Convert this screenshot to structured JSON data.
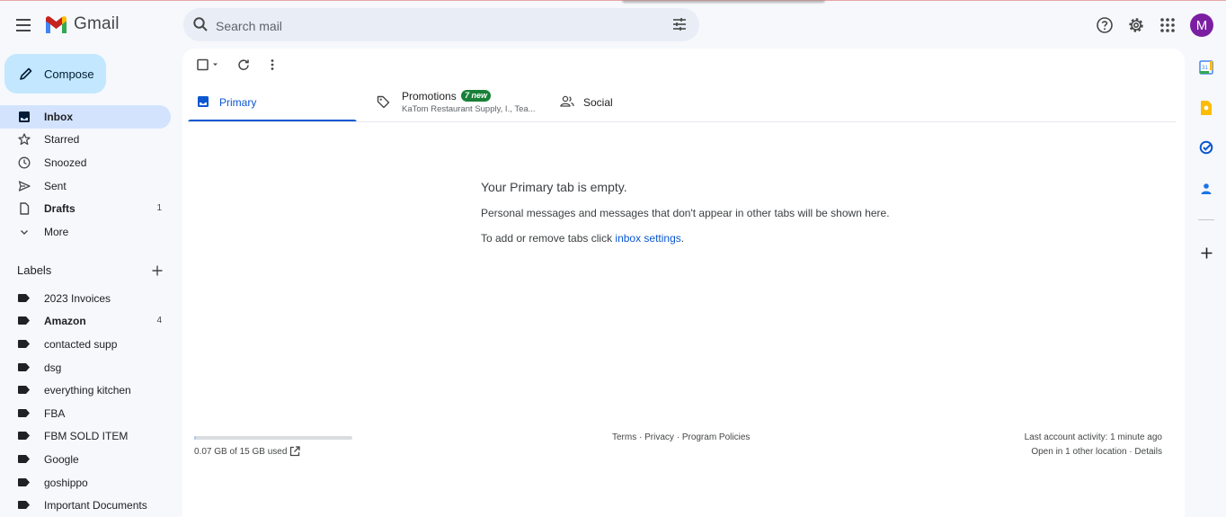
{
  "app": {
    "name": "Gmail"
  },
  "search": {
    "placeholder": "Search mail"
  },
  "account": {
    "avatar_letter": "M"
  },
  "compose": {
    "label": "Compose"
  },
  "nav": {
    "items": [
      {
        "label": "Inbox",
        "count": ""
      },
      {
        "label": "Starred",
        "count": ""
      },
      {
        "label": "Snoozed",
        "count": ""
      },
      {
        "label": "Sent",
        "count": ""
      },
      {
        "label": "Drafts",
        "count": "1"
      },
      {
        "label": "More",
        "count": ""
      }
    ]
  },
  "labels": {
    "title": "Labels",
    "items": [
      {
        "label": "2023 Invoices",
        "count": ""
      },
      {
        "label": "Amazon",
        "count": "4"
      },
      {
        "label": "contacted supp",
        "count": ""
      },
      {
        "label": "dsg",
        "count": ""
      },
      {
        "label": "everything kitchen",
        "count": ""
      },
      {
        "label": "FBA",
        "count": ""
      },
      {
        "label": "FBM SOLD ITEM",
        "count": ""
      },
      {
        "label": "Google",
        "count": ""
      },
      {
        "label": "goshippo",
        "count": ""
      },
      {
        "label": "Important Documents",
        "count": ""
      }
    ]
  },
  "tabs": [
    {
      "label": "Primary"
    },
    {
      "label": "Promotions",
      "badge": "7 new",
      "subtitle": "KaTom Restaurant Supply, I., Tea..."
    },
    {
      "label": "Social"
    }
  ],
  "empty": {
    "title": "Your Primary tab is empty.",
    "line1": "Personal messages and messages that don't appear in other tabs will be shown here.",
    "line2_prefix": "To add or remove tabs click ",
    "line2_link": "inbox settings",
    "line2_suffix": "."
  },
  "storage": {
    "text": "0.07 GB of 15 GB used",
    "fraction": 0.005
  },
  "footer": {
    "terms": "Terms",
    "privacy": "Privacy",
    "policies": "Program Policies",
    "sep": " · ",
    "activity": "Last account activity: 1 minute ago",
    "other_location": "Open in 1 other location",
    "details": "Details"
  },
  "colors": {
    "accent": "#0b57d0",
    "compose_bg": "#c2e7ff",
    "active_nav_bg": "#d3e3fd",
    "badge_bg": "#188038",
    "avatar_bg": "#7b1fa2"
  }
}
